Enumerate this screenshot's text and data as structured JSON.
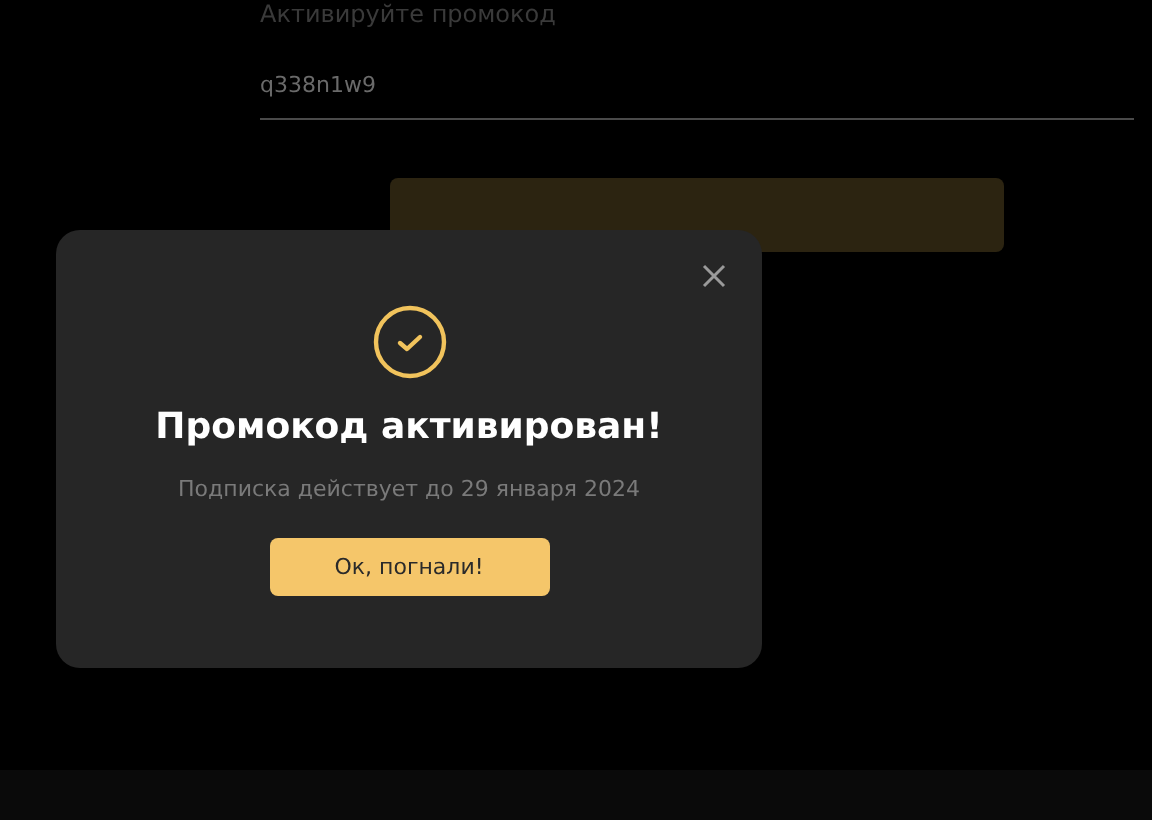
{
  "promo_form": {
    "heading": "Активируйте промокод",
    "value": "q338n1w9"
  },
  "dialog": {
    "title": "Промокод активирован!",
    "message": "Подписка действует до 29 января 2024",
    "button": "Ок, погнали!"
  }
}
